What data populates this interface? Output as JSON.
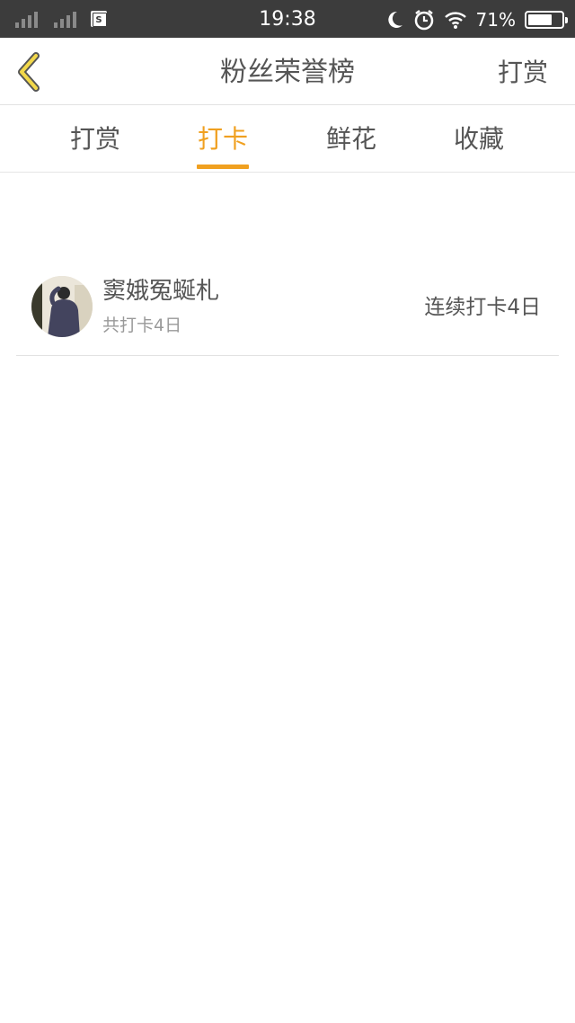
{
  "status_bar": {
    "time": "19:38",
    "battery_percent": "71%",
    "battery_level": 0.71,
    "sim_label": "S",
    "icons": [
      "signal-icon",
      "signal-icon",
      "sim-icon",
      "moon-icon",
      "alarm-icon",
      "wifi-icon",
      "battery-icon"
    ]
  },
  "nav": {
    "title": "粉丝荣誉榜",
    "right_action": "打赏",
    "back_icon": "chevron-left-icon",
    "back_color": "#f2d84a"
  },
  "tabs": [
    {
      "label": "打赏",
      "active": false
    },
    {
      "label": "打卡",
      "active": true
    },
    {
      "label": "鲜花",
      "active": false
    },
    {
      "label": "收藏",
      "active": false
    }
  ],
  "accent_color": "#f0a020",
  "list": [
    {
      "name": "窦娥冤蜒札",
      "total": "共打卡4日",
      "streak": "连续打卡4日",
      "avatar_icon": "avatar"
    }
  ]
}
